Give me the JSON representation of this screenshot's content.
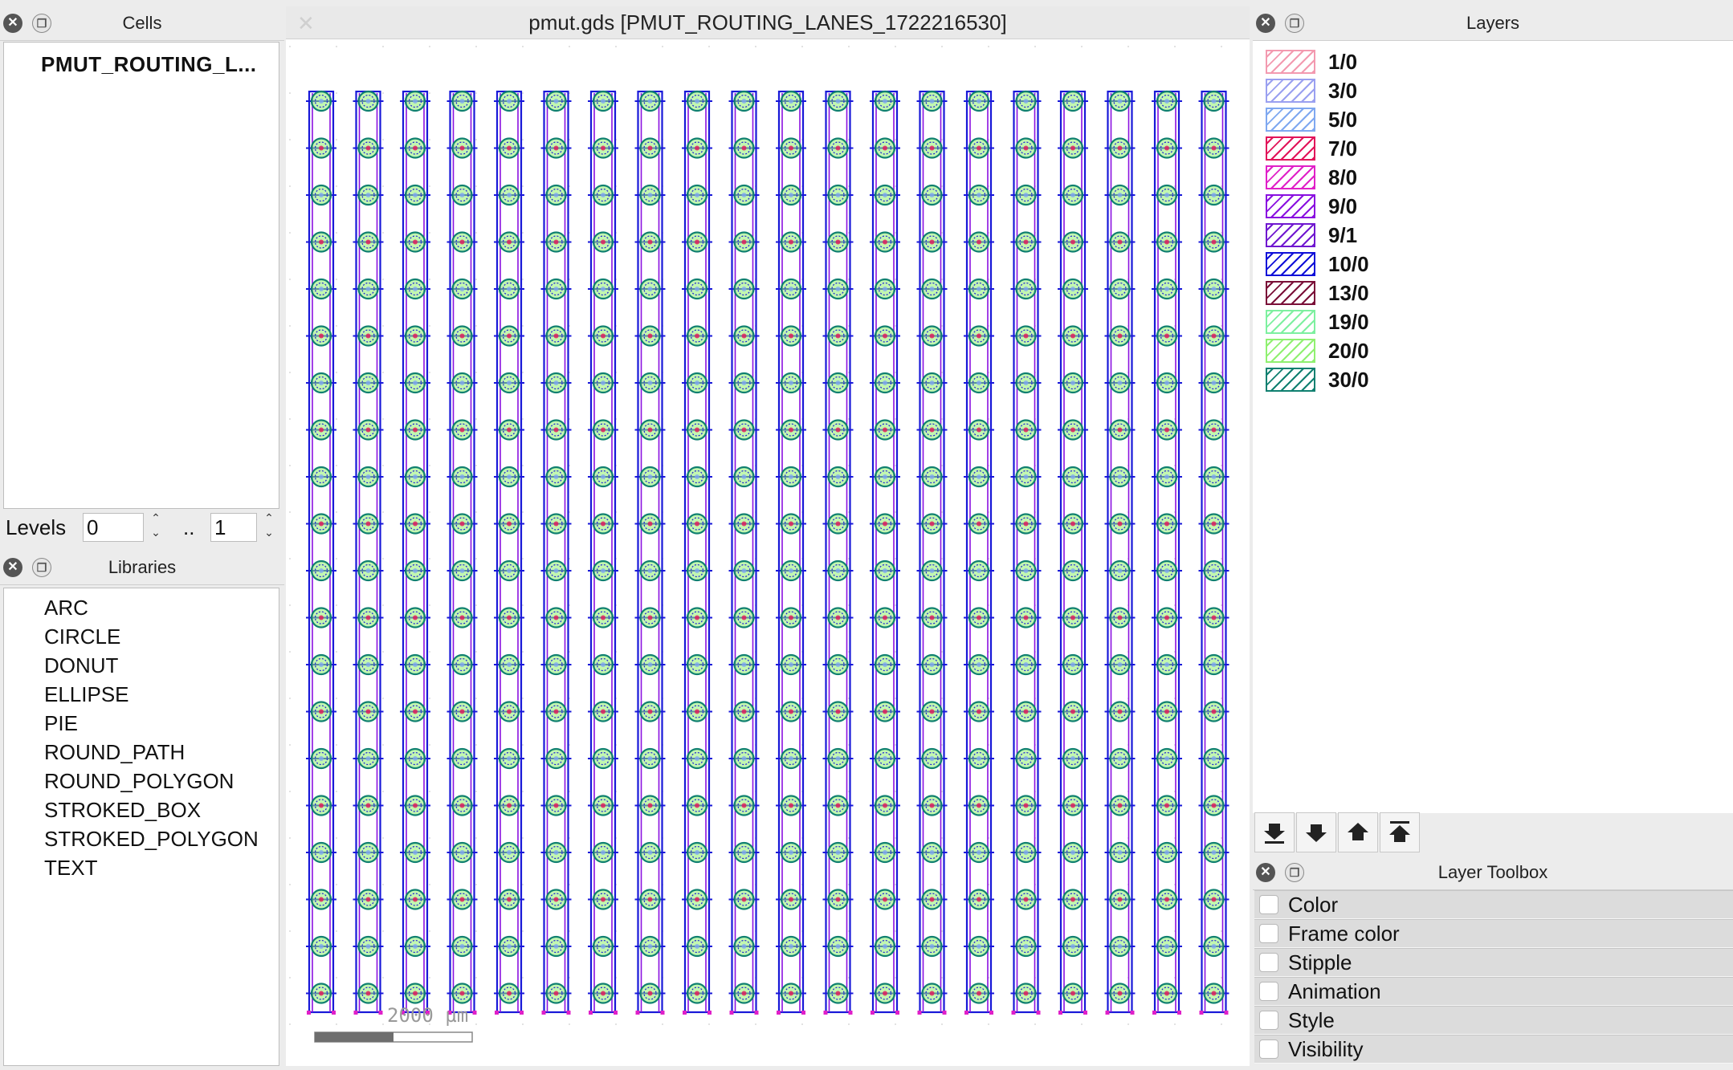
{
  "cells_panel": {
    "title": "Cells",
    "cell": "PMUT_ROUTING_L..."
  },
  "levels": {
    "label": "Levels",
    "from": "0",
    "sep": "..",
    "to": "1"
  },
  "libraries_panel": {
    "title": "Libraries",
    "items": [
      "ARC",
      "CIRCLE",
      "DONUT",
      "ELLIPSE",
      "PIE",
      "ROUND_PATH",
      "ROUND_POLYGON",
      "STROKED_BOX",
      "STROKED_POLYGON",
      "TEXT"
    ]
  },
  "canvas": {
    "title": "pmut.gds [PMUT_ROUTING_LANES_1722216530]",
    "scale_label": "2000 µm"
  },
  "layers_panel": {
    "title": "Layers",
    "layers": [
      {
        "name": "1/0",
        "color": "#f39ab0"
      },
      {
        "name": "3/0",
        "color": "#9aa0f0"
      },
      {
        "name": "5/0",
        "color": "#7fa8f0"
      },
      {
        "name": "7/0",
        "color": "#e2145a"
      },
      {
        "name": "8/0",
        "color": "#e020c8"
      },
      {
        "name": "9/0",
        "color": "#8a10e0"
      },
      {
        "name": "9/1",
        "color": "#7018d0"
      },
      {
        "name": "10/0",
        "color": "#1010d8"
      },
      {
        "name": "13/0",
        "color": "#7a1038"
      },
      {
        "name": "19/0",
        "color": "#7ef0a0"
      },
      {
        "name": "20/0",
        "color": "#90f070"
      },
      {
        "name": "30/0",
        "color": "#108070"
      }
    ],
    "tool_icons": [
      "move-to-bottom-icon",
      "move-down-icon",
      "move-up-icon",
      "move-to-top-icon"
    ]
  },
  "toolbox": {
    "title": "Layer Toolbox",
    "sections": [
      "Color",
      "Frame color",
      "Stipple",
      "Animation",
      "Style",
      "Visibility"
    ]
  }
}
